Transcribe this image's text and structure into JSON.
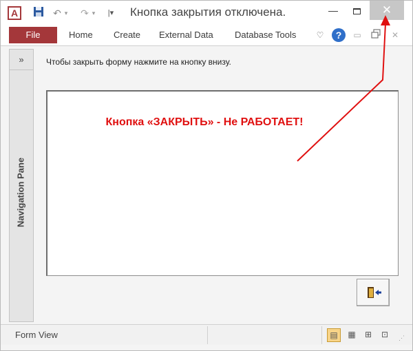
{
  "titlebar": {
    "app_icon": "A",
    "title": "Кнопка закрытия отключена.",
    "icons": [
      "access-app-icon",
      "save-icon",
      "undo-icon",
      "redo-icon",
      "customize-qat-icon",
      "minimize-icon",
      "maximize-icon",
      "close-icon"
    ]
  },
  "ribbon": {
    "file_label": "File",
    "tabs": [
      "Home",
      "Create",
      "External Data",
      "Database Tools"
    ],
    "file_color": "#a4373a",
    "help_color": "#2f6fc9"
  },
  "navpane": {
    "toggle_label": "»",
    "label": "Navigation Pane"
  },
  "form": {
    "instruction": "Чтобы закрыть форму нажмите на кнопку внизу.",
    "exit_button_icon": "exit-door-icon"
  },
  "annotation": {
    "text": "Кнопка «ЗАКРЫТЬ» - Не РАБОТАЕТ!",
    "color": "#e01010"
  },
  "statusbar": {
    "text": "Form View",
    "views": [
      "form-view-icon",
      "datasheet-view-icon",
      "layout-view-icon",
      "design-view-icon"
    ],
    "active_view_color": "#f8d488"
  }
}
